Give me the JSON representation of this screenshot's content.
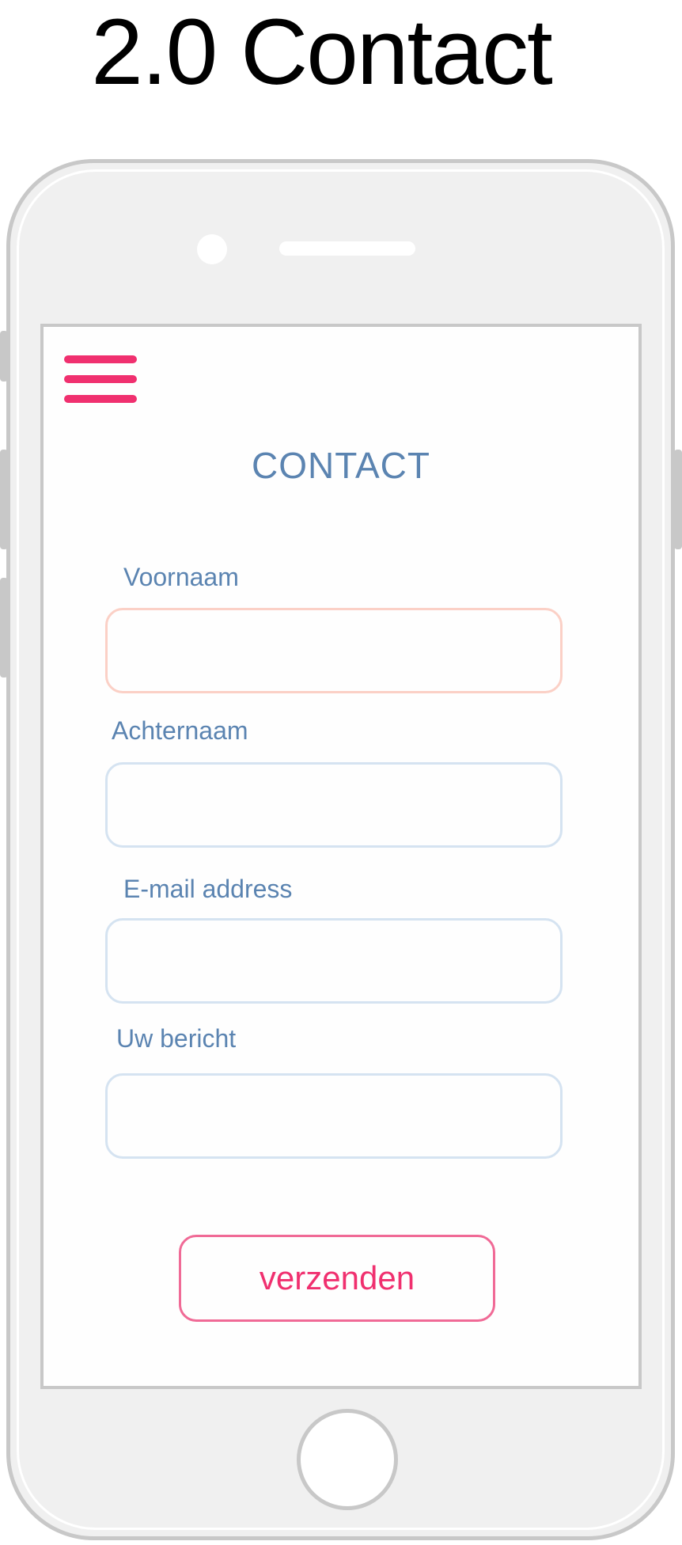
{
  "page": {
    "heading": "2.0 Contact"
  },
  "screen": {
    "title": "CONTACT",
    "menu_icon": "hamburger-menu-icon"
  },
  "form": {
    "fields": [
      {
        "label": "Voornaam",
        "value": "",
        "placeholder": ""
      },
      {
        "label": "Achternaam",
        "value": "",
        "placeholder": ""
      },
      {
        "label": "E-mail address",
        "value": "",
        "placeholder": ""
      },
      {
        "label": "Uw bericht",
        "value": "",
        "placeholder": ""
      }
    ],
    "submit_label": "verzenden"
  },
  "colors": {
    "accent_pink": "#f0306f",
    "label_blue": "#5b84b1",
    "input_border": "#d5e3f1",
    "focused_border": "#fbd0c6",
    "frame_gray": "#c8c8c8"
  }
}
